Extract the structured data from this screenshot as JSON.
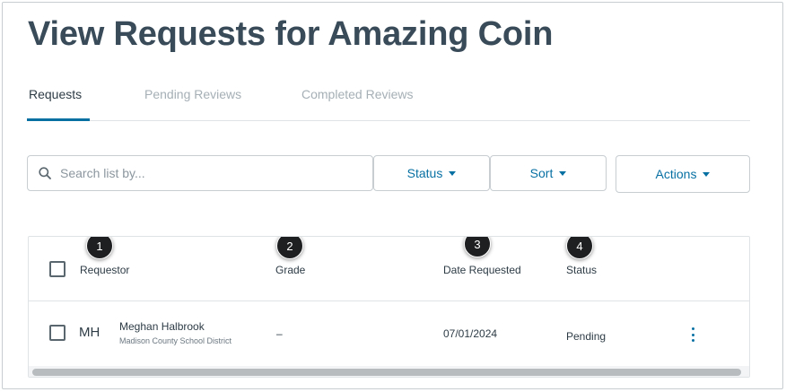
{
  "page": {
    "title": "View Requests for Amazing Coin"
  },
  "tabs": [
    {
      "label": "Requests",
      "active": true
    },
    {
      "label": "Pending Reviews",
      "active": false
    },
    {
      "label": "Completed Reviews",
      "active": false
    }
  ],
  "toolbar": {
    "search_placeholder": "Search list by...",
    "search_value": "",
    "search_icon": "search-icon",
    "status_label": "Status",
    "sort_label": "Sort",
    "actions_label": "Actions"
  },
  "table": {
    "columns": [
      "Requestor",
      "Grade",
      "Date Requested",
      "Status"
    ],
    "callouts": [
      "1",
      "2",
      "3",
      "4"
    ],
    "rows": [
      {
        "initials": "MH",
        "name": "Meghan Halbrook",
        "district": "Madison County School District",
        "grade": "–",
        "date": "07/01/2024",
        "status": "Pending"
      }
    ]
  },
  "colors": {
    "accent": "#0770a3",
    "title": "#394b58",
    "text": "#2d3b45",
    "muted": "#a5afb5",
    "border": "#c7cdd1"
  }
}
